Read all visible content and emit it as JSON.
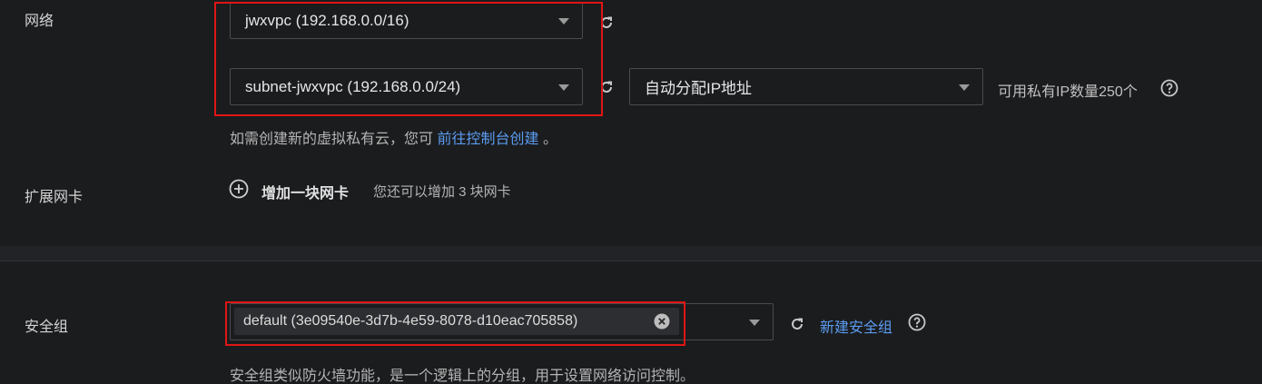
{
  "network": {
    "label": "网络",
    "vpc_value": "jwxvpc (192.168.0.0/16)",
    "subnet_value": "subnet-jwxvpc (192.168.0.0/24)",
    "ip_mode_value": "自动分配IP地址",
    "available_ip_text": "可用私有IP数量250个",
    "create_hint_prefix": "如需创建新的虚拟私有云，您可",
    "create_hint_link": "前往控制台创建",
    "create_hint_suffix": "。"
  },
  "extend_nic": {
    "label": "扩展网卡",
    "add_button_label": "增加一块网卡",
    "remaining_text": "您还可以增加 3 块网卡"
  },
  "security_group": {
    "label": "安全组",
    "selected_tag": "default (3e09540e-3d7b-4e59-8078-d10eac705858)",
    "new_link": "新建安全组",
    "description": "安全组类似防火墙功能，是一个逻辑上的分组，用于设置网络访问控制。"
  },
  "colors": {
    "background": "#1b1c1e",
    "link": "#5b9bf0",
    "highlight": "#e01515"
  },
  "icons": [
    "refresh-icon",
    "chevron-down-icon",
    "help-icon",
    "add-circle-icon",
    "clear-icon"
  ]
}
